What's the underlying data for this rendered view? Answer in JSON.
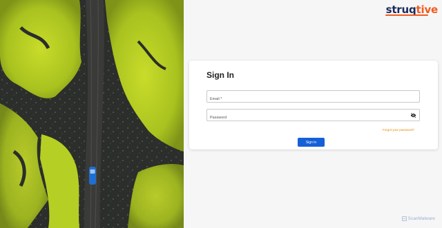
{
  "brand": {
    "logo_part1": "struq",
    "logo_part2": "tive",
    "colors": {
      "navy": "#1b2a5e",
      "orange": "#f25a1e"
    }
  },
  "hero": {
    "image_description_icon": "aerial-road-image"
  },
  "signin": {
    "title": "Sign In",
    "email_placeholder": "Email *",
    "password_placeholder": "Password",
    "password_visibility_icon": "eye-off-icon",
    "forgot_link": "Forgot your password?",
    "submit_label": "Sign in",
    "accent_color": "#1560d8",
    "link_color": "#e68a00"
  },
  "watermark": {
    "text": "ScanMalware",
    "icon": "scan-icon"
  }
}
